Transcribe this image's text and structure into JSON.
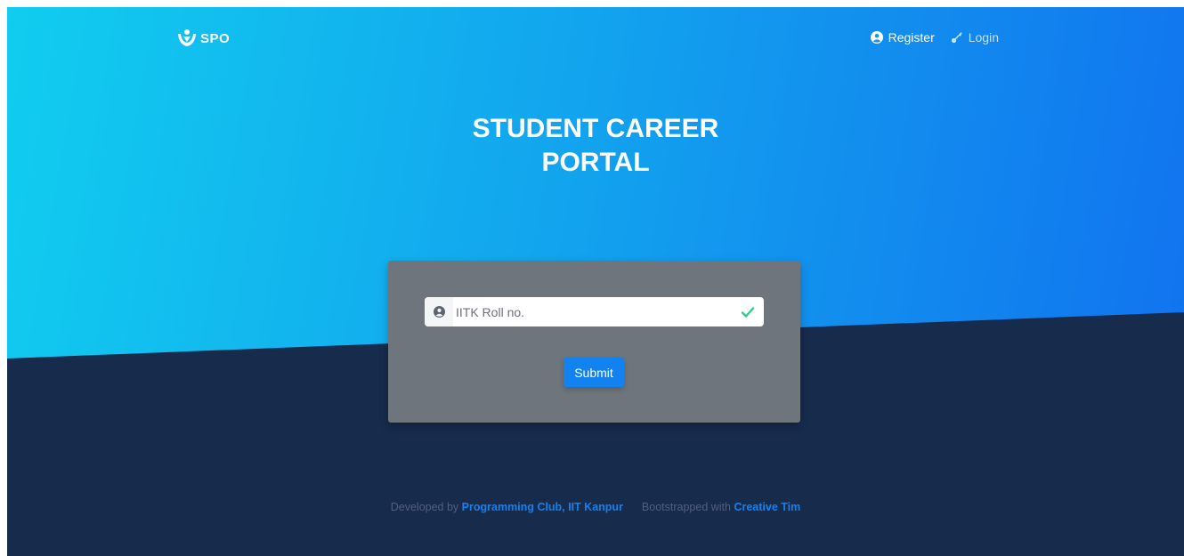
{
  "brand": {
    "name": "SPO"
  },
  "nav": {
    "register_label": "Register",
    "login_label": "Login"
  },
  "hero": {
    "title_line1": "STUDENT CAREER",
    "title_line2": "PORTAL"
  },
  "form": {
    "roll_placeholder": "IITK Roll no.",
    "roll_value": "",
    "submit_label": "Submit"
  },
  "footer": {
    "developed_prefix": "Developed by",
    "developer_link": "Programming Club, IIT Kanpur",
    "bootstrapped_prefix": "Bootstrapped with",
    "bootstrap_link": "Creative Tim"
  },
  "colors": {
    "gradient_start": "#11cdef",
    "gradient_end": "#1171ef",
    "dark_background": "#172b4d",
    "card_background": "#6e757c",
    "primary": "#1182ef",
    "success": "#2dce89"
  },
  "icons": {
    "brand": "spo-logo-icon",
    "register": "user-circle-icon",
    "login": "key-icon",
    "input_prefix": "user-circle-icon",
    "input_valid": "check-icon"
  }
}
